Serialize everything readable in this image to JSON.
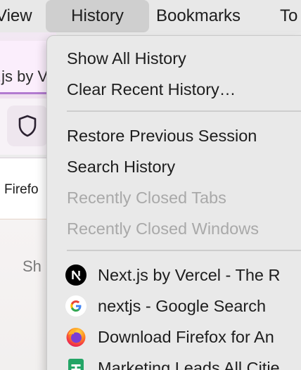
{
  "menubar": {
    "view": "View",
    "history": "History",
    "bookmarks": "Bookmarks",
    "tools": "To"
  },
  "browser": {
    "tab_title": ".js by V",
    "suggestion": "Firefo",
    "content_text": "Sh"
  },
  "history_menu": {
    "show_all": "Show All History",
    "clear_recent": "Clear Recent History…",
    "restore_session": "Restore Previous Session",
    "search": "Search History",
    "recently_closed_tabs": "Recently Closed Tabs",
    "recently_closed_windows": "Recently Closed Windows",
    "entries": [
      {
        "label": "Next.js by Vercel - The R",
        "icon": "nextjs-icon"
      },
      {
        "label": "nextjs - Google Search",
        "icon": "google-icon"
      },
      {
        "label": "Download Firefox for An",
        "icon": "firefox-icon"
      },
      {
        "label": "Marketing Leads All Citie",
        "icon": "google-sheets-icon"
      }
    ]
  },
  "colors": {
    "menu_background": "#e9e9e9",
    "menubar_highlight": "#cfcfcf",
    "disabled_text": "#a9a9a9",
    "tab_accent": "#b27bd0"
  }
}
